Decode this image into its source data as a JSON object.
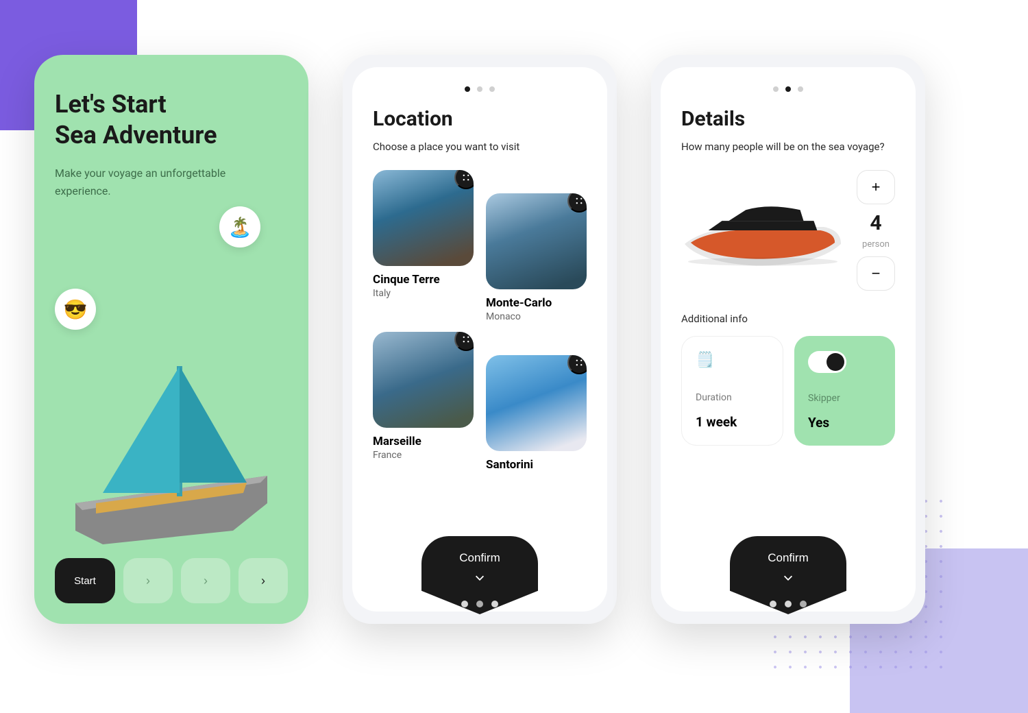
{
  "screen1": {
    "title_line1": "Let's Start",
    "title_line2": "Sea Adventure",
    "subtitle": "Make your voyage an unforgettable experience.",
    "start_label": "Start",
    "bubble_icons": {
      "palm": "🏝️",
      "cool": "😎"
    }
  },
  "screen2": {
    "title": "Location",
    "subtitle": "Choose a place you want to visit",
    "locations": [
      {
        "name": "Cinque Terre",
        "country": "Italy"
      },
      {
        "name": "Monte-Carlo",
        "country": "Monaco"
      },
      {
        "name": "Marseille",
        "country": "France"
      },
      {
        "name": "Santorini",
        "country": ""
      }
    ],
    "confirm_label": "Confirm",
    "active_top_dot": 0,
    "active_bottom_dot": 1
  },
  "screen3": {
    "title": "Details",
    "subtitle": "How many people will be on the sea voyage?",
    "people_count": "4",
    "people_unit": "person",
    "additional_label": "Additional info",
    "duration_label": "Duration",
    "duration_value": "1 week",
    "skipper_label": "Skipper",
    "skipper_value": "Yes",
    "confirm_label": "Confirm",
    "active_top_dot": 1,
    "active_bottom_dot": 2
  }
}
